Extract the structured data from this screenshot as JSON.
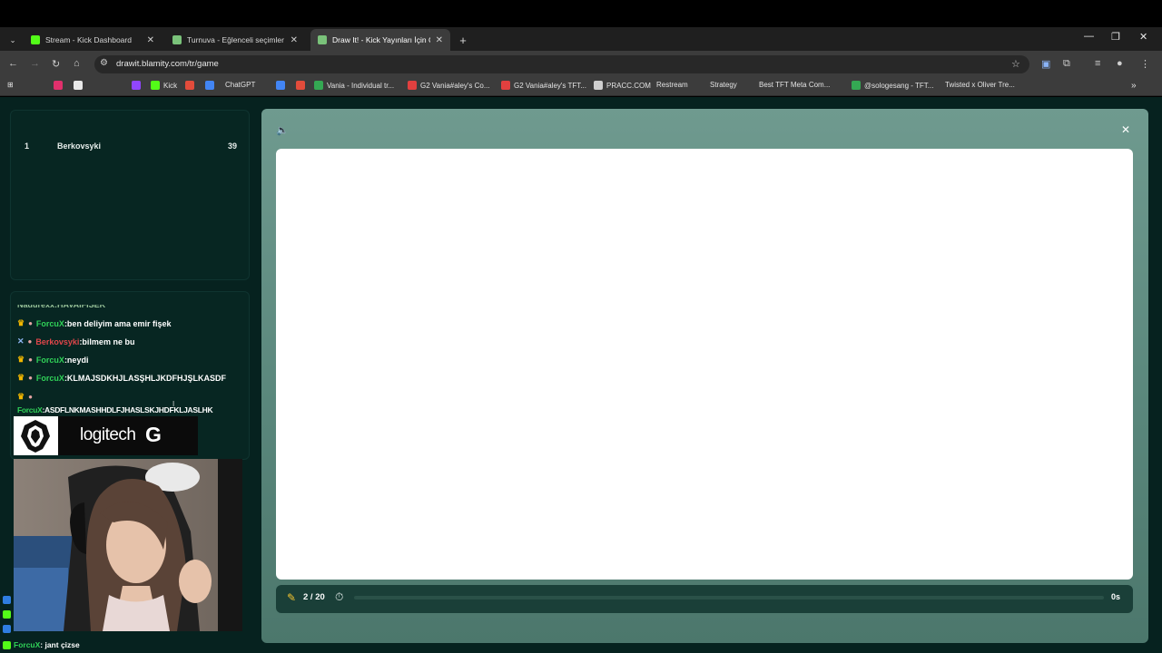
{
  "browser": {
    "tabs": [
      {
        "title": "Stream - Kick Dashboard",
        "favicon_color": "#53fc18"
      },
      {
        "title": "Turnuva - Eğlenceli seçimler yap",
        "favicon_color": "#7ac27a"
      },
      {
        "title": "Draw It! - Kick Yayınları İçin Çiz",
        "favicon_color": "#7ac27a"
      }
    ],
    "new_tab": "+",
    "url": "drawit.blamity.com/tr/game",
    "bookmarks": [
      {
        "label": "",
        "color": "#25d366"
      },
      {
        "label": "",
        "color": "#e1306c"
      },
      {
        "label": "",
        "color": "#e8e8e8"
      },
      {
        "label": "",
        "color": "#ff0000"
      },
      {
        "label": "",
        "color": "#ff5252"
      },
      {
        "label": "",
        "color": "#9146ff"
      },
      {
        "label": "Kick",
        "color": "#53fc18"
      },
      {
        "label": "",
        "color": "#e34c3b"
      },
      {
        "label": "",
        "color": "#4285f4"
      },
      {
        "label": "ChatGPT",
        "color": "#cfcfcf"
      },
      {
        "label": "",
        "color": "#4285f4"
      },
      {
        "label": "",
        "color": "#e34c3b"
      },
      {
        "label": "Vania - Individual tr...",
        "color": "#34a853"
      },
      {
        "label": "G2 Vania#aley's Co...",
        "color": "#e2403f"
      },
      {
        "label": "G2 Vania#aley's TFT...",
        "color": "#e2403f"
      },
      {
        "label": "PRACC.COM",
        "color": "#cfcfcf"
      },
      {
        "label": "Restream",
        "color": "#2f6cf5"
      },
      {
        "label": "Strategy",
        "color": "#cfcfcf"
      },
      {
        "label": "Best TFT Meta Com...",
        "color": "#cfcfcf"
      },
      {
        "label": "@sologesang - TFT...",
        "color": "#34a853"
      },
      {
        "label": "Twisted x Oliver Tre...",
        "color": "#ff0000"
      }
    ]
  },
  "leaderboard": {
    "rows": [
      {
        "rank": "1",
        "name": "Berkovsyki",
        "score": "39"
      }
    ]
  },
  "chat": {
    "partial_top": "Nadurexx:HAVAIFISEK",
    "lines": [
      {
        "user": "ForcuX",
        "text": ":ben deliyim ama emir fişek"
      },
      {
        "user": "Berkovsyki",
        "text": ":bilmem ne bu"
      },
      {
        "user": "ForcuX",
        "text": ":neydi"
      },
      {
        "user": "ForcuX",
        "text": ":KLMAJSDKHJLASŞHLJKDFHJŞLKASDF"
      },
      {
        "user": "ForcuX",
        "text": ":ASDFLNKMASHHDLFJHASLSKJHDFKLJASLHK"
      }
    ]
  },
  "sponsor": {
    "text": "logitech",
    "mark": "G"
  },
  "stream_overlay": {
    "lines": [
      {
        "user": "",
        "text": ""
      },
      {
        "user": "",
        "text": ""
      },
      {
        "user": "",
        "text": ""
      },
      {
        "user": "ForcuX",
        "text": ": jant çizse"
      }
    ]
  },
  "game": {
    "round": "2 / 20",
    "time_left": "0s",
    "progress": 0.0
  }
}
